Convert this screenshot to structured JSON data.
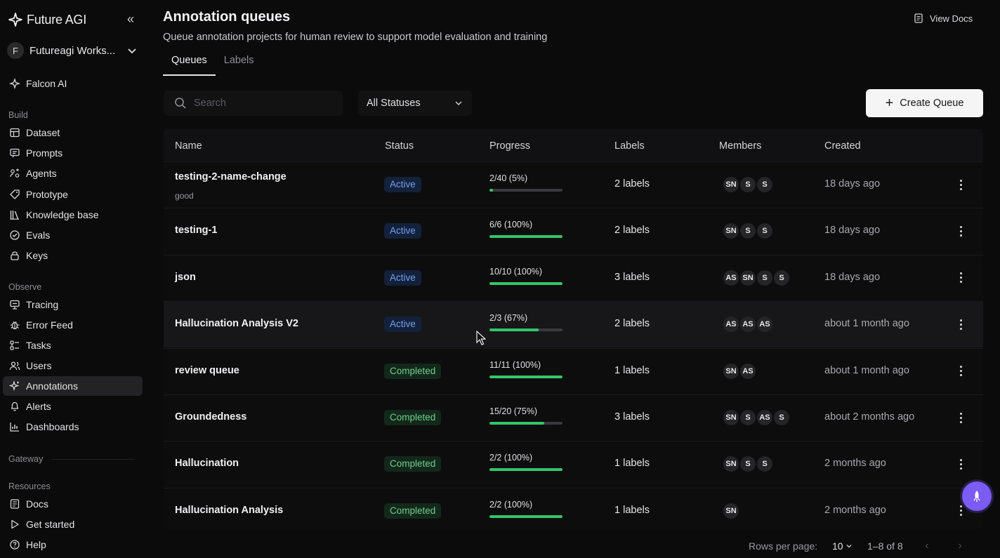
{
  "brand": {
    "name": "Future AGI"
  },
  "workspace": {
    "initial": "F",
    "name": "Futureagi Works..."
  },
  "sidebar": {
    "top_item": {
      "label": "Falcon AI",
      "icon": "falcon-icon"
    },
    "sections": {
      "build": "Build",
      "observe": "Observe",
      "gateway": "Gateway",
      "resources": "Resources"
    },
    "build_items": [
      {
        "label": "Dataset",
        "icon": "table-icon"
      },
      {
        "label": "Prompts",
        "icon": "prompt-icon"
      },
      {
        "label": "Agents",
        "icon": "agent-icon"
      },
      {
        "label": "Prototype",
        "icon": "tag-icon"
      },
      {
        "label": "Knowledge base",
        "icon": "library-icon"
      },
      {
        "label": "Evals",
        "icon": "check-circle-icon"
      },
      {
        "label": "Keys",
        "icon": "lock-icon"
      }
    ],
    "observe_items": [
      {
        "label": "Tracing",
        "icon": "tracing-icon"
      },
      {
        "label": "Error Feed",
        "icon": "bug-icon"
      },
      {
        "label": "Tasks",
        "icon": "tasks-icon"
      },
      {
        "label": "Users",
        "icon": "users-icon"
      },
      {
        "label": "Annotations",
        "icon": "sparkle-icon",
        "active": true
      },
      {
        "label": "Alerts",
        "icon": "bell-icon"
      },
      {
        "label": "Dashboards",
        "icon": "chart-icon"
      }
    ],
    "resource_items": [
      {
        "label": "Docs",
        "icon": "docs-icon"
      },
      {
        "label": "Get started",
        "icon": "play-icon"
      },
      {
        "label": "Help",
        "icon": "help-icon"
      }
    ]
  },
  "header": {
    "title": "Annotation queues",
    "subtitle": "Queue annotation projects for human review to support model evaluation and training",
    "view_docs": "View Docs"
  },
  "tabs": [
    {
      "label": "Queues",
      "active": true
    },
    {
      "label": "Labels",
      "active": false
    }
  ],
  "toolbar": {
    "search_placeholder": "Search",
    "status_filter": "All Statuses",
    "create_label": "Create Queue"
  },
  "table": {
    "columns": [
      "Name",
      "Status",
      "Progress",
      "Labels",
      "Members",
      "Created"
    ],
    "rows": [
      {
        "name": "testing-2-name-change",
        "description": "good",
        "status": "Active",
        "progress_text": "2/40 (5%)",
        "progress": 0.05,
        "labels": "2 labels",
        "members": [
          "SN",
          "S",
          "S"
        ],
        "created": "18 days ago"
      },
      {
        "name": "testing-1",
        "description": "",
        "status": "Active",
        "progress_text": "6/6 (100%)",
        "progress": 1.0,
        "labels": "2 labels",
        "members": [
          "SN",
          "S",
          "S"
        ],
        "created": "18 days ago"
      },
      {
        "name": "json",
        "description": "",
        "status": "Active",
        "progress_text": "10/10 (100%)",
        "progress": 1.0,
        "labels": "3 labels",
        "members": [
          "AS",
          "SN",
          "S",
          "S"
        ],
        "created": "18 days ago"
      },
      {
        "name": "Hallucination Analysis V2",
        "description": "",
        "status": "Active",
        "progress_text": "2/3 (67%)",
        "progress": 0.67,
        "labels": "2 labels",
        "members": [
          "AS",
          "AS",
          "AS"
        ],
        "created": "about 1 month ago",
        "hover": true
      },
      {
        "name": "review queue",
        "description": "",
        "status": "Completed",
        "progress_text": "11/11 (100%)",
        "progress": 1.0,
        "labels": "1 labels",
        "members": [
          "SN",
          "AS"
        ],
        "created": "about 1 month ago"
      },
      {
        "name": "Groundedness",
        "description": "",
        "status": "Completed",
        "progress_text": "15/20 (75%)",
        "progress": 0.75,
        "labels": "3 labels",
        "members": [
          "SN",
          "S",
          "AS",
          "S"
        ],
        "created": "about 2 months ago"
      },
      {
        "name": "Hallucination",
        "description": "",
        "status": "Completed",
        "progress_text": "2/2 (100%)",
        "progress": 1.0,
        "labels": "1 labels",
        "members": [
          "SN",
          "S",
          "S"
        ],
        "created": "2 months ago"
      },
      {
        "name": "Hallucination Analysis",
        "description": "",
        "status": "Completed",
        "progress_text": "2/2 (100%)",
        "progress": 1.0,
        "labels": "1 labels",
        "members": [
          "SN"
        ],
        "created": "2 months ago"
      }
    ]
  },
  "pagination": {
    "rows_per_page_label": "Rows per page:",
    "rows_per_page": "10",
    "range": "1–8 of 8"
  },
  "colors": {
    "accent": "#7b5cf5",
    "active_badge": "#73a0ef",
    "completed_badge": "#6fcf8a",
    "progress_fill": "#33c56a"
  }
}
